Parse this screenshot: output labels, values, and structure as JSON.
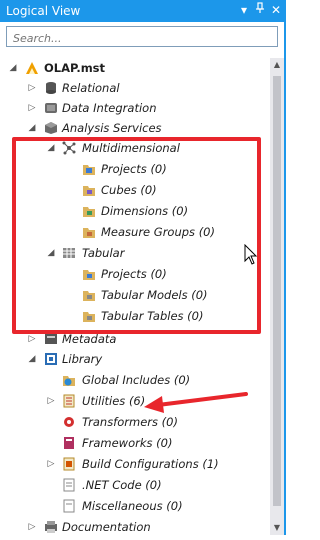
{
  "titlebar": {
    "title": "Logical View",
    "controls": [
      "dropdown-icon",
      "pin-icon",
      "close-icon"
    ]
  },
  "search": {
    "placeholder": "Search..."
  },
  "tree": [
    {
      "label": "OLAP.mst",
      "icon": "project-icon",
      "bold": true,
      "expanded": true
    },
    {
      "label": "Relational",
      "icon": "database-icon",
      "expanded": false
    },
    {
      "label": "Data Integration",
      "icon": "data-integration-icon",
      "expanded": false
    },
    {
      "label": "Analysis Services",
      "icon": "analysis-services-icon",
      "expanded": true
    },
    {
      "label": "Multidimensional",
      "icon": "multidimensional-icon",
      "expanded": true
    },
    {
      "label": "Projects (0)",
      "icon": "folder-icon"
    },
    {
      "label": "Cubes (0)",
      "icon": "folder-icon"
    },
    {
      "label": "Dimensions (0)",
      "icon": "folder-icon"
    },
    {
      "label": "Measure Groups (0)",
      "icon": "folder-icon"
    },
    {
      "label": "Tabular",
      "icon": "tabular-icon",
      "expanded": true
    },
    {
      "label": "Projects (0)",
      "icon": "folder-icon"
    },
    {
      "label": "Tabular Models (0)",
      "icon": "folder-icon"
    },
    {
      "label": "Tabular Tables (0)",
      "icon": "folder-icon"
    },
    {
      "label": "Metadata",
      "icon": "metadata-icon",
      "expanded": false
    },
    {
      "label": "Library",
      "icon": "library-icon",
      "expanded": true
    },
    {
      "label": "Global Includes (0)",
      "icon": "global-includes-icon"
    },
    {
      "label": "Utilities (6)",
      "icon": "utilities-icon",
      "expanded": false
    },
    {
      "label": "Transformers (0)",
      "icon": "transformers-icon"
    },
    {
      "label": "Frameworks (0)",
      "icon": "frameworks-icon"
    },
    {
      "label": "Build Configurations (1)",
      "icon": "build-config-icon",
      "expanded": false
    },
    {
      "label": ".NET Code (0)",
      "icon": "dotnet-code-icon"
    },
    {
      "label": "Miscellaneous (0)",
      "icon": "miscellaneous-icon"
    },
    {
      "label": "Documentation",
      "icon": "documentation-icon",
      "expanded": false
    }
  ],
  "colors": {
    "titlebar": "#1c97ea",
    "highlight_box": "#e8262c",
    "arrow": "#e8262c"
  }
}
